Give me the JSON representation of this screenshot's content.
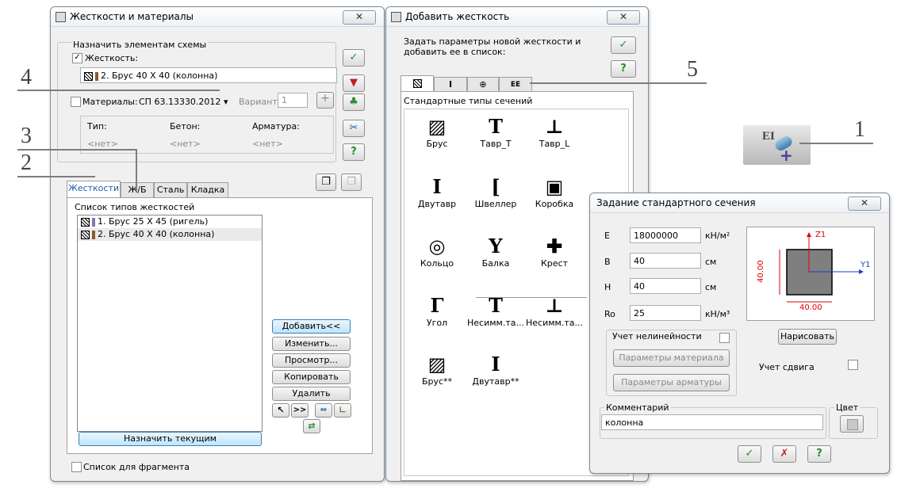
{
  "win1": {
    "title": "Жесткости и материалы",
    "assign_group": "Назначить элементам схемы",
    "stiffness_label": "Жесткость:",
    "stiffness_value": "2. Брус 40 X 40 (колонна)",
    "materials_label": "Материалы:",
    "materials_value": "СП 63.13330.2012",
    "variant_label": "Вариант",
    "variant_value": "1",
    "table_headers": [
      "Тип:",
      "Бетон:",
      "Арматура:"
    ],
    "table_values": [
      "<нет>",
      "<нет>",
      "<нет>"
    ],
    "tabs": [
      "Жесткости",
      "Ж/Б",
      "Сталь",
      "Кладка"
    ],
    "list_title": "Список типов жесткостей",
    "list_items": [
      "1. Брус 25 X 45 (ригель)",
      "2. Брус 40 X 40 (колонна)"
    ],
    "buttons": [
      "Добавить<<",
      "Изменить...",
      "Просмотр...",
      "Копировать",
      "Удалить"
    ],
    "assign_current": "Назначить текущим",
    "fragment_label": "Список для фрагмента",
    "colors": {
      "item1": "#8e6fb5",
      "item2": "#8b5a2b",
      "accent": "#1c5fb0"
    }
  },
  "win2": {
    "title": "Добавить жесткость",
    "instruction": "Задать параметры новой жесткости и добавить ее в список:",
    "tab_icons": [
      "hatch-icon",
      "i-beam-icon",
      "circle-icon",
      "ee-icon"
    ],
    "tab_ee": "EE",
    "group_title": "Стандартные типы сечений",
    "sections": [
      {
        "label": "Брус",
        "glyph": "▨",
        "icon": "rect-section-icon"
      },
      {
        "label": "Тавр_Т",
        "glyph": "T",
        "icon": "tee-section-icon"
      },
      {
        "label": "Тавр_L",
        "glyph": "⊥",
        "icon": "tee-l-section-icon"
      },
      {
        "label": "Двутавр",
        "glyph": "I",
        "icon": "i-section-icon"
      },
      {
        "label": "Швеллер",
        "glyph": "[",
        "icon": "channel-section-icon"
      },
      {
        "label": "Коробка",
        "glyph": "▣",
        "icon": "box-section-icon"
      },
      {
        "label": "Кольцо",
        "glyph": "◎",
        "icon": "ring-section-icon"
      },
      {
        "label": "Балка",
        "glyph": "Y",
        "icon": "beam-section-icon"
      },
      {
        "label": "Крест",
        "glyph": "✚",
        "icon": "cross-section-icon"
      },
      {
        "label": "Угол",
        "glyph": "Γ",
        "icon": "angle-section-icon"
      },
      {
        "label": "Несимм.та...",
        "glyph": "T",
        "icon": "asym-tee-icon"
      },
      {
        "label": "Несимм.та...",
        "glyph": "⊥",
        "icon": "asym-tee-l-icon"
      },
      {
        "label": "Брус**",
        "glyph": "▨",
        "icon": "rect2-section-icon"
      },
      {
        "label": "Двутавр**",
        "glyph": "I",
        "icon": "i2-section-icon"
      }
    ]
  },
  "win3": {
    "title": "Задание стандартного сечения",
    "params": [
      {
        "name": "E",
        "value": "18000000",
        "unit": "кН/м²"
      },
      {
        "name": "B",
        "value": "40",
        "unit": "см"
      },
      {
        "name": "H",
        "value": "40",
        "unit": "см"
      },
      {
        "name": "Ro",
        "value": "25",
        "unit": "кН/м³"
      }
    ],
    "axis_z": "Z1",
    "axis_y": "Y1",
    "dim_h": "40.00",
    "dim_w": "40.00",
    "draw_button": "Нарисовать",
    "nonlinear_label": "Учет нелинейности",
    "material_params": "Параметры материала",
    "rebar_params": "Параметры арматуры",
    "shear_label": "Учет сдвига",
    "comment_label": "Комментарий",
    "comment_value": "колонна",
    "color_label": "Цвет"
  },
  "callouts": [
    "1",
    "2",
    "3",
    "4",
    "5"
  ],
  "ei_icon_text": "EI"
}
